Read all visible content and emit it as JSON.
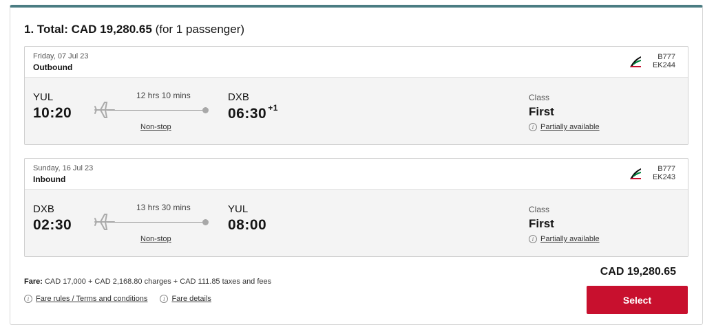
{
  "summary": {
    "title_prefix": "1. Total: CAD 19,280.65",
    "title_suffix": "(for 1 passenger)"
  },
  "legs": [
    {
      "date": "Friday, 07 Jul 23",
      "direction": "Outbound",
      "aircraft": "B777",
      "flight": "EK244",
      "origin_code": "YUL",
      "depart_time": "10:20",
      "duration": "12 hrs 10 mins",
      "stops": "Non-stop",
      "dest_code": "DXB",
      "arrive_time": "06:30",
      "day_offset": "+1",
      "class_label": "Class",
      "class_value": "First",
      "availability": "Partially available"
    },
    {
      "date": "Sunday, 16 Jul 23",
      "direction": "Inbound",
      "aircraft": "B777",
      "flight": "EK243",
      "origin_code": "DXB",
      "depart_time": "02:30",
      "duration": "13 hrs 30 mins",
      "stops": "Non-stop",
      "dest_code": "YUL",
      "arrive_time": "08:00",
      "day_offset": "",
      "class_label": "Class",
      "class_value": "First",
      "availability": "Partially available"
    }
  ],
  "fare": {
    "label": "Fare:",
    "breakdown": "CAD 17,000 + CAD 2,168.80 charges + CAD 111.85 taxes and fees",
    "rules_link": "Fare rules / Terms and conditions",
    "details_link": "Fare details"
  },
  "price_total": "CAD 19,280.65",
  "select_label": "Select",
  "colors": {
    "accent_border": "#4a7c82",
    "select_button": "#c8102e",
    "leg_body_bg": "#f4f4f4"
  },
  "icons": {
    "airline_logo": "emirates-logo-icon",
    "plane": "plane-icon",
    "info": "info-icon"
  }
}
